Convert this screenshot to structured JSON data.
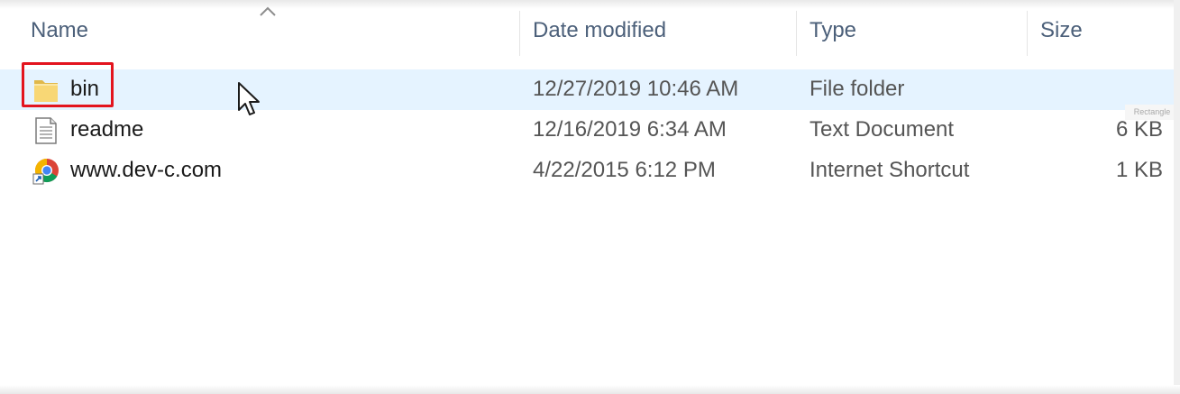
{
  "columns": {
    "name": "Name",
    "date": "Date modified",
    "type": "Type",
    "size": "Size"
  },
  "rows": [
    {
      "name": "bin",
      "date": "12/27/2019 10:46 AM",
      "type": "File folder",
      "size": "",
      "icon": "folder-icon",
      "selected": true
    },
    {
      "name": "readme",
      "date": "12/16/2019 6:34 AM",
      "type": "Text Document",
      "size": "6 KB",
      "icon": "text-document-icon",
      "selected": false
    },
    {
      "name": "www.dev-c.com",
      "date": "4/22/2015 6:12 PM",
      "type": "Internet Shortcut",
      "size": "1 KB",
      "icon": "chrome-shortcut-icon",
      "selected": false
    }
  ],
  "overlay": {
    "rect_tag": "Rectangle"
  },
  "colors": {
    "selection": "#e5f3ff",
    "highlight_box": "#e3141e",
    "header_text": "#4c607a"
  }
}
